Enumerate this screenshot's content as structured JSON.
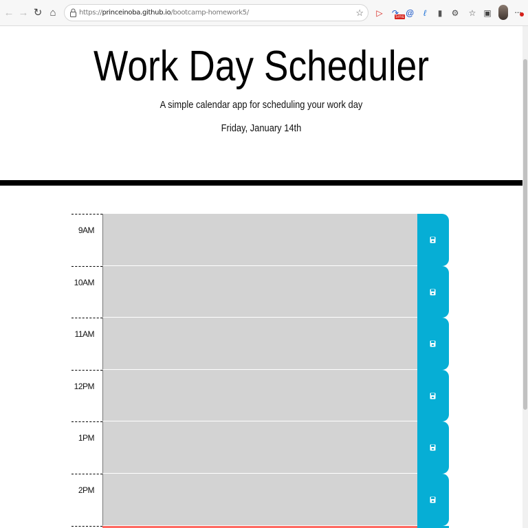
{
  "browser": {
    "url_scheme": "https://",
    "url_host": "princeinoba.github.io",
    "url_path": "/bootcamp-homework5/",
    "extension_badge": "5ms",
    "icons": [
      "back-icon",
      "forward-icon",
      "refresh-icon",
      "home-icon",
      "lock-icon",
      "bookmark-star-icon",
      "extensions-icons",
      "favorites-icon",
      "collections-icon",
      "profile-avatar",
      "more-icon"
    ]
  },
  "header": {
    "title": "Work Day Scheduler",
    "lead": "A simple calendar app for scheduling your work day",
    "current_day": "Friday, January 14th"
  },
  "schedule": {
    "rows": [
      {
        "hour": "9AM",
        "status": "past",
        "text": ""
      },
      {
        "hour": "10AM",
        "status": "past",
        "text": ""
      },
      {
        "hour": "11AM",
        "status": "past",
        "text": ""
      },
      {
        "hour": "12PM",
        "status": "past",
        "text": ""
      },
      {
        "hour": "1PM",
        "status": "past",
        "text": ""
      },
      {
        "hour": "2PM",
        "status": "past",
        "text": ""
      }
    ],
    "colors": {
      "past": "#d3d3d3",
      "present": "#ff6961",
      "save": "#06aed5"
    },
    "save_icon": "save-icon"
  }
}
